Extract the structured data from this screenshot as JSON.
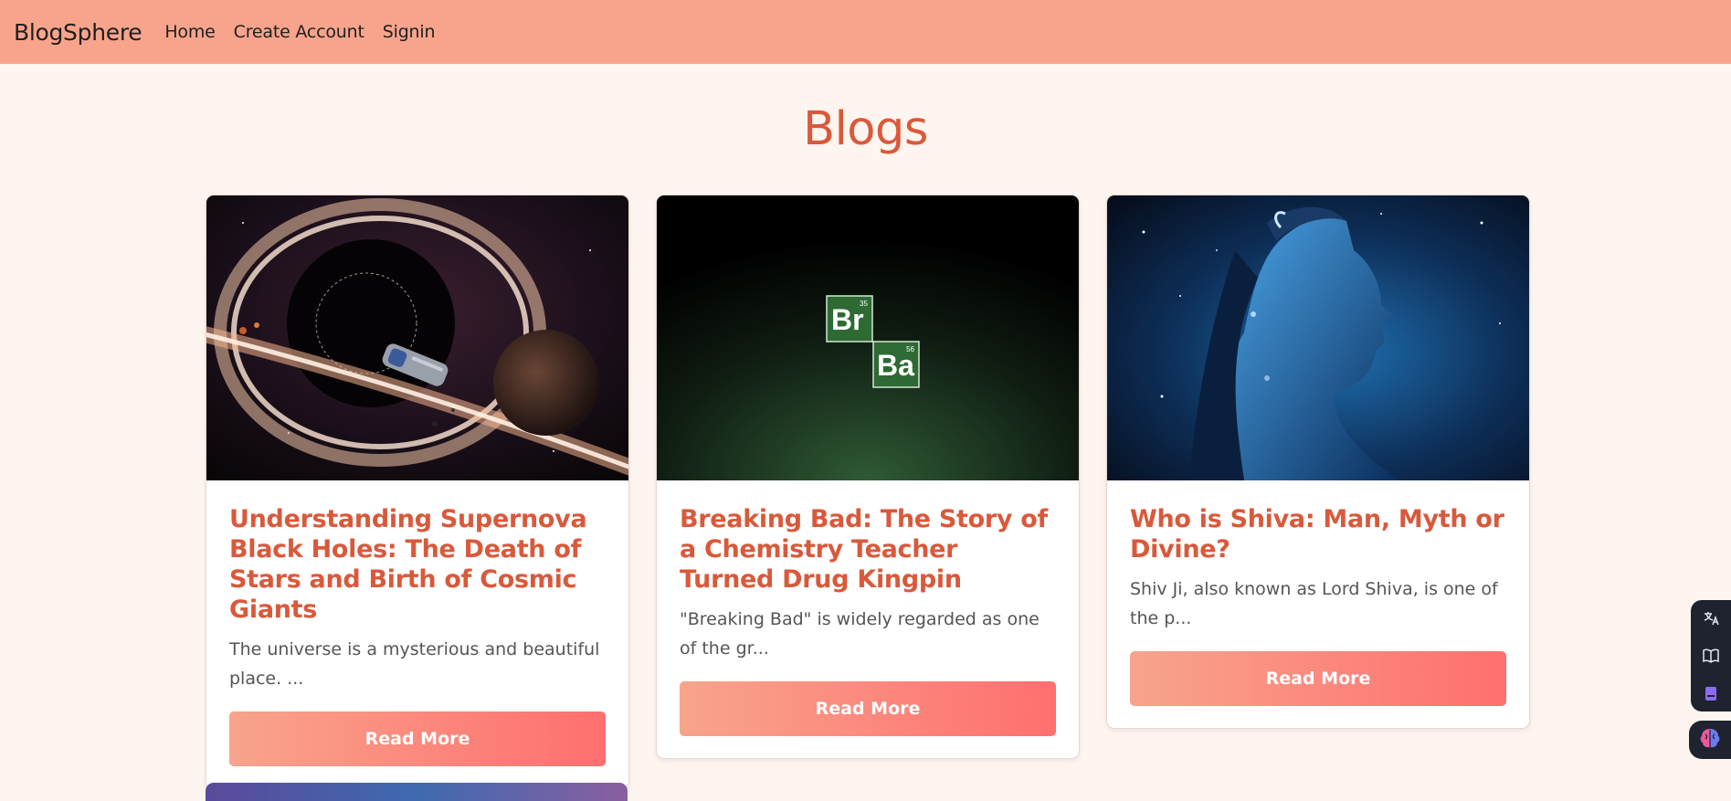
{
  "nav": {
    "brand": "BlogSphere",
    "links": [
      {
        "label": "Home"
      },
      {
        "label": "Create Account"
      },
      {
        "label": "Signin"
      }
    ]
  },
  "page": {
    "title": "Blogs"
  },
  "cards": [
    {
      "image": "black-hole-spaceship-illustration",
      "title": "Understanding Supernova Black Holes: The Death of Stars and Birth of Cosmic Giants",
      "excerpt": "The universe is a mysterious and beautiful place. ...",
      "button": "Read More"
    },
    {
      "image": "breaking-bad-logo",
      "title": "Breaking Bad: The Story of a Chemistry Teacher Turned Drug Kingpin",
      "excerpt": "\"Breaking Bad\" is widely regarded as one of the gr...",
      "button": "Read More",
      "logo": {
        "el1_symbol": "Br",
        "el1_number": "35",
        "el2_symbol": "Ba",
        "el2_number": "56"
      }
    },
    {
      "image": "shiva-cosmic-illustration",
      "title": "Who is Shiva: Man, Myth or Divine?",
      "excerpt": "Shiv Ji, also known as Lord Shiva, is one of the p...",
      "button": "Read More"
    }
  ],
  "side_toolbar": {
    "icons": [
      "translate-icon",
      "book-icon",
      "bookmark-icon"
    ],
    "bottom_icon": "brain-icon"
  },
  "colors": {
    "navbar": "#f8a48c",
    "accent": "#d9593b",
    "background": "#fff5f0",
    "button_start": "#f8a48c",
    "button_end": "#ff6f6f"
  }
}
